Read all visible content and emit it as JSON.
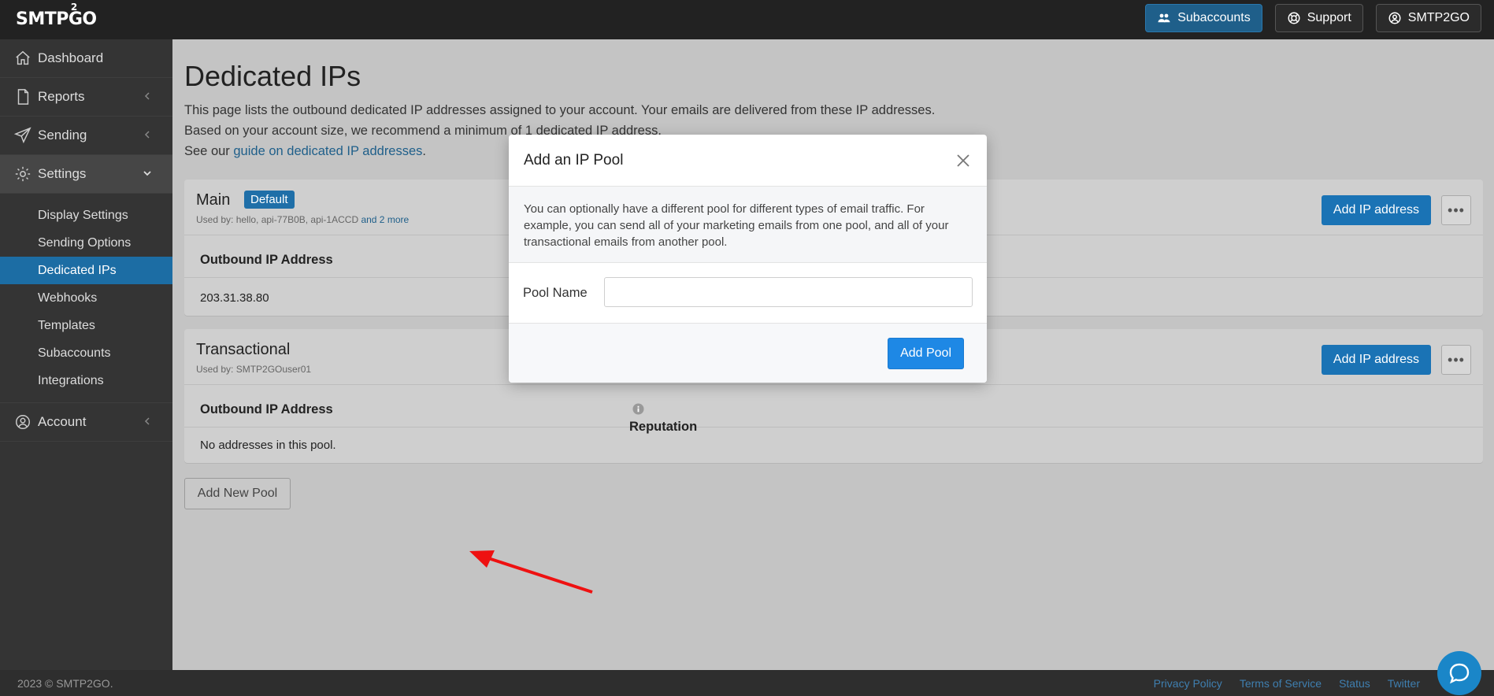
{
  "brand": {
    "logo_text_a": "SMTP",
    "logo_text_b": "GO",
    "logo_sup": "2"
  },
  "topbar": {
    "subaccounts": "Subaccounts",
    "support": "Support",
    "account": "SMTP2GO"
  },
  "sidebar": {
    "dashboard": "Dashboard",
    "reports": "Reports",
    "sending": "Sending",
    "settings": "Settings",
    "account": "Account",
    "settings_items": [
      "Display Settings",
      "Sending Options",
      "Dedicated IPs",
      "Webhooks",
      "Templates",
      "Subaccounts",
      "Integrations"
    ]
  },
  "page": {
    "title": "Dedicated IPs",
    "intro_line1": "This page lists the outbound dedicated IP addresses assigned to your account. Your emails are delivered from these IP addresses.",
    "intro_line2": "Based on your account size, we recommend a minimum of 1 dedicated IP address.",
    "intro_line3_prefix": "See our ",
    "intro_line3_link": "guide on dedicated IP addresses",
    "intro_line3_suffix": "."
  },
  "pools": [
    {
      "name": "Main",
      "badge": "Default",
      "used_by": "Used by: hello, api-77B0B, api-1ACCD",
      "used_by_more": "and 2 more",
      "add_ip_label": "Add IP address",
      "col_address": "Outbound IP Address",
      "row": "203.31.38.80"
    },
    {
      "name": "Transactional",
      "used_by": "Used by: SMTP2GOuser01",
      "add_ip_label": "Add IP address",
      "col_address": "Outbound IP Address",
      "col_reputation": "Reputation",
      "row": "No addresses in this pool."
    }
  ],
  "add_new_pool": "Add New Pool",
  "modal": {
    "title": "Add an IP Pool",
    "description": "You can optionally have a different pool for different types of email traffic. For example, you can send all of your marketing emails from one pool, and all of your transactional emails from another pool.",
    "field_label": "Pool Name",
    "field_value": "",
    "submit": "Add Pool"
  },
  "footer": {
    "copyright": "2023 © SMTP2GO.",
    "links": [
      "Privacy Policy",
      "Terms of Service",
      "Status",
      "Twitter"
    ]
  },
  "colors": {
    "accent": "#1a73b5",
    "active_nav": "#1c6da4",
    "arrow": "#ee1111"
  }
}
